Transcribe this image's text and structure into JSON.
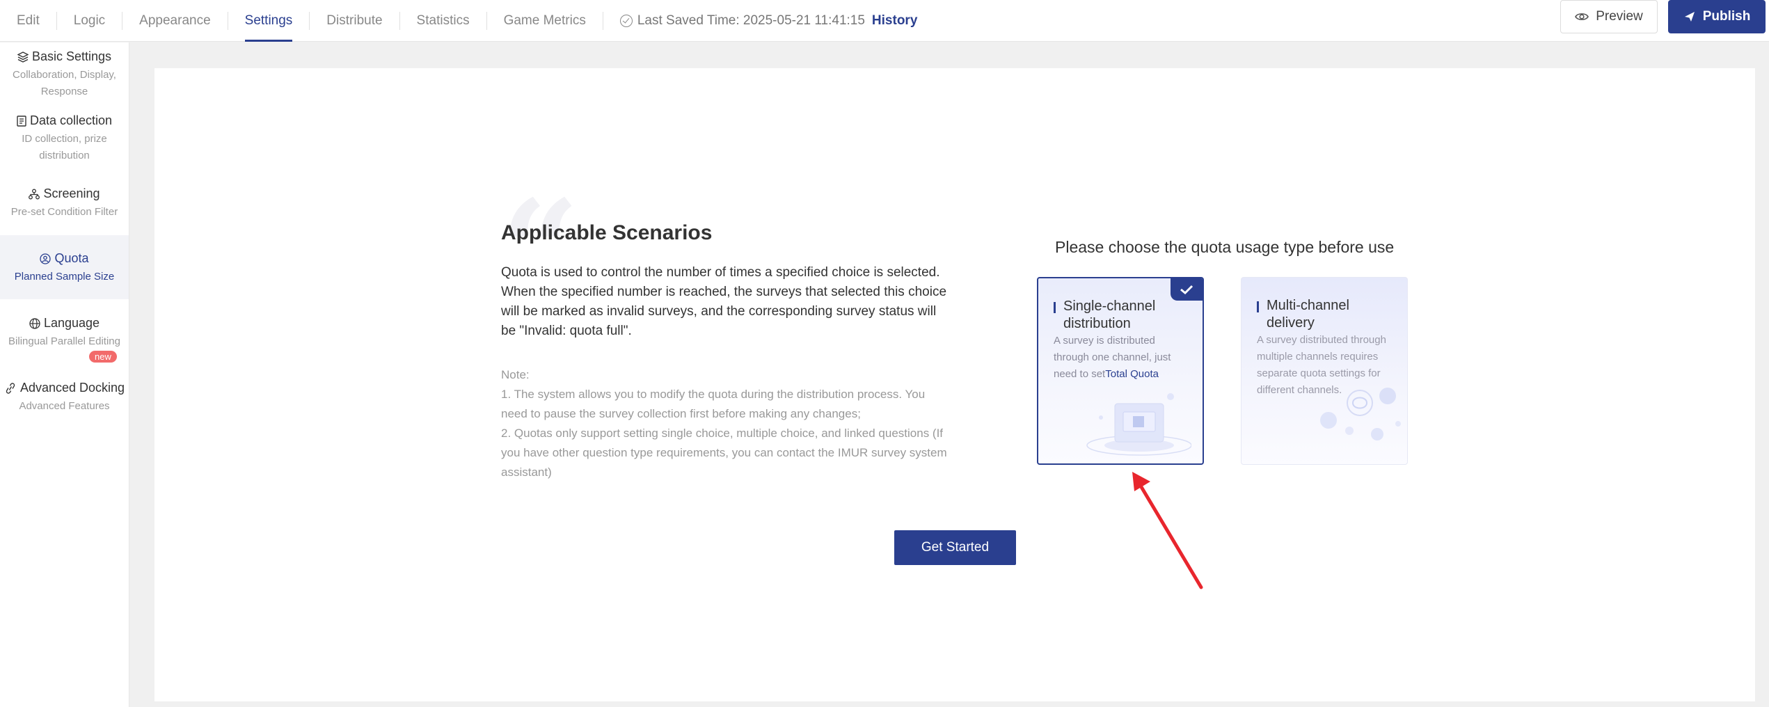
{
  "topbar": {
    "tabs": [
      {
        "label": "Edit"
      },
      {
        "label": "Logic"
      },
      {
        "label": "Appearance"
      },
      {
        "label": "Settings"
      },
      {
        "label": "Distribute"
      },
      {
        "label": "Statistics"
      },
      {
        "label": "Game Metrics"
      }
    ],
    "active_tab": "Settings",
    "saved_text": "Last Saved Time: 2025-05-21 11:41:15",
    "history_label": "History",
    "preview_label": "Preview",
    "publish_label": "Publish"
  },
  "sidebar": {
    "items": [
      {
        "title": "Basic Settings",
        "sub": "Collaboration, Display, Response",
        "icon": "layers-icon"
      },
      {
        "title": "Data collection",
        "sub": "ID collection, prize distribution",
        "icon": "document-icon"
      },
      {
        "title": "Screening",
        "sub": "Pre-set Condition Filter",
        "icon": "hierarchy-icon"
      },
      {
        "title": "Quota",
        "sub": "Planned Sample Size",
        "icon": "person-circle-icon",
        "active": true
      },
      {
        "title": "Language",
        "sub": "Bilingual Parallel Editing",
        "icon": "globe-icon",
        "badge": "new"
      },
      {
        "title": "Advanced Docking",
        "sub": "Advanced Features",
        "icon": "link-icon"
      }
    ]
  },
  "main": {
    "heading": "Applicable Scenarios",
    "description": "Quota is used to control the number of times a specified choice is selected. When the specified number is reached, the surveys that selected this choice will be marked as invalid surveys, and the corresponding survey status will be \"Invalid: quota full\".",
    "note_label": "Note:",
    "note_1": "1. The system allows you to modify the quota during the distribution process. You need to pause the survey collection first before making any changes;",
    "note_2": "2. Quotas only support setting single choice, multiple choice, and linked questions (If you have other question type requirements, you can contact the IMUR survey system assistant)",
    "choose_title": "Please choose the quota usage type before use",
    "cards": {
      "single": {
        "title": "Single-channel distribution",
        "desc": "A survey is distributed through one channel, just need to set",
        "highlight": "Total Quota",
        "selected": true
      },
      "multi": {
        "title": "Multi-channel delivery",
        "desc": "A survey distributed through multiple channels requires separate quota settings for different channels."
      }
    },
    "start_label": "Get Started"
  },
  "colors": {
    "accent": "#2a3f8f",
    "badge": "#f26a6a",
    "annotation_arrow": "#e8262d"
  }
}
